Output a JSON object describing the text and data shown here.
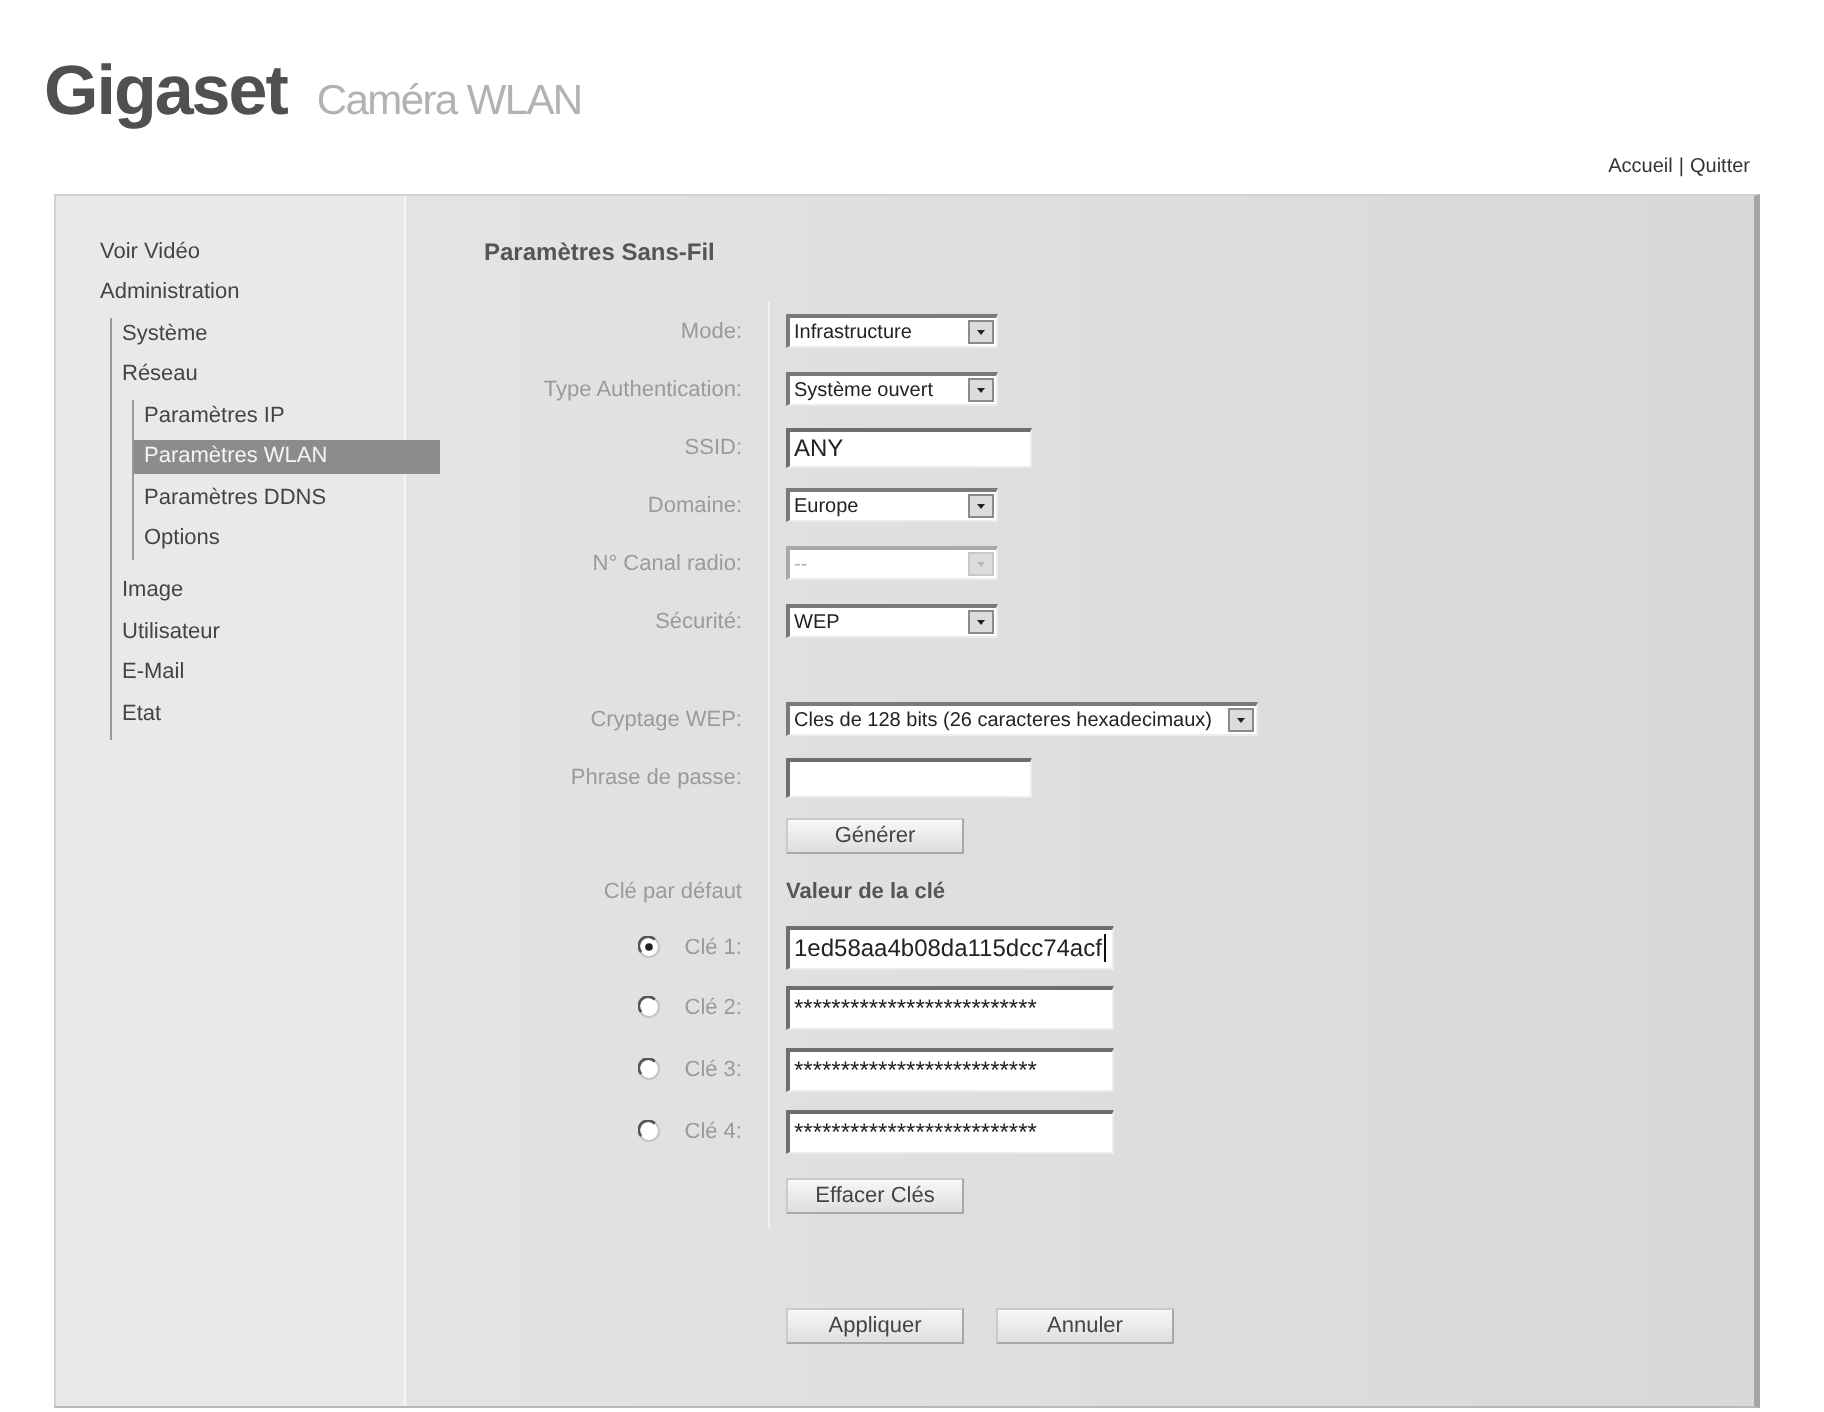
{
  "header": {
    "brand": "Gigaset",
    "product": "Caméra WLAN",
    "links": [
      "Accueil",
      "Quitter"
    ],
    "separator": "|"
  },
  "sidebar": {
    "items": [
      {
        "label": "Voir Vidéo",
        "selected": false
      },
      {
        "label": "Administration",
        "selected": false,
        "children": [
          {
            "label": "Système",
            "selected": false
          },
          {
            "label": "Réseau",
            "selected": false,
            "children": [
              {
                "label": "Paramètres IP",
                "selected": false
              },
              {
                "label": "Paramètres WLAN",
                "selected": true
              },
              {
                "label": "Paramètres DDNS",
                "selected": false
              },
              {
                "label": "Options",
                "selected": false
              }
            ]
          },
          {
            "label": "Image",
            "selected": false
          },
          {
            "label": "Utilisateur",
            "selected": false
          },
          {
            "label": "E-Mail",
            "selected": false
          },
          {
            "label": "Etat",
            "selected": false
          }
        ]
      }
    ]
  },
  "wireless": {
    "title": "Paramètres Sans-Fil",
    "fields": [
      {
        "kind": "select",
        "label": "Mode:",
        "value": "Infrastructure",
        "disabled": false
      },
      {
        "kind": "select",
        "label": "Type Authentication:",
        "value": "Système ouvert",
        "disabled": false
      },
      {
        "kind": "text",
        "label": "SSID:",
        "value": "ANY"
      },
      {
        "kind": "select",
        "label": "Domaine:",
        "value": "Europe",
        "disabled": false
      },
      {
        "kind": "select",
        "label": "N° Canal radio:",
        "value": "--",
        "disabled": true
      },
      {
        "kind": "select",
        "label": "Sécurité:",
        "value": "WEP",
        "disabled": false
      }
    ]
  },
  "wep": {
    "fields": [
      {
        "kind": "select",
        "label": "Cryptage WEP:",
        "value": "Cles de 128 bits (26 caracteres hexadecimaux)",
        "disabled": false
      },
      {
        "kind": "text",
        "label": "Phrase de passe:"
      }
    ],
    "generate_button": "Générer",
    "default_key_label": "Clé par défaut",
    "key_value_heading": "Valeur de la clé",
    "keys": [
      {
        "label": "Clé 1:",
        "value": "1ed58aa4b08da115dcc74acf",
        "selected": true,
        "focused": true
      },
      {
        "label": "Clé 2:",
        "value": "**************************",
        "selected": false,
        "focused": false
      },
      {
        "label": "Clé 3:",
        "value": "**************************",
        "selected": false,
        "focused": false
      },
      {
        "label": "Clé 4:",
        "value": "**************************",
        "selected": false,
        "focused": false
      }
    ],
    "clear_button": "Effacer Clés"
  },
  "buttons": [
    "Appliquer",
    "Annuler"
  ]
}
